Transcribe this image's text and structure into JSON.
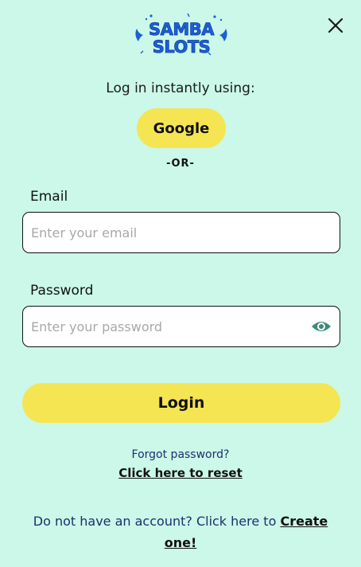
{
  "brand": {
    "logo_line1": "SAMBA",
    "logo_line2": "SLOTS",
    "colors": {
      "background": "#cbf8e8",
      "button_yellow": "#f5e553",
      "logo_blue": "#1d5fd6",
      "eye_green": "#3e8a78",
      "link_navy": "#1d2f6f"
    }
  },
  "close": {
    "icon": "close-icon"
  },
  "social": {
    "prompt": "Log in instantly using:",
    "google_label": "Google",
    "separator": "-OR-"
  },
  "form": {
    "email": {
      "label": "Email",
      "placeholder": "Enter your email",
      "value": ""
    },
    "password": {
      "label": "Password",
      "placeholder": "Enter your password",
      "value": "",
      "toggle_icon": "eye-icon"
    },
    "login_label": "Login"
  },
  "forgot": {
    "prompt": "Forgot password?",
    "link": "Click here to reset"
  },
  "signup": {
    "prompt": "Do not have an account? Click here to",
    "link": "Create one!"
  }
}
